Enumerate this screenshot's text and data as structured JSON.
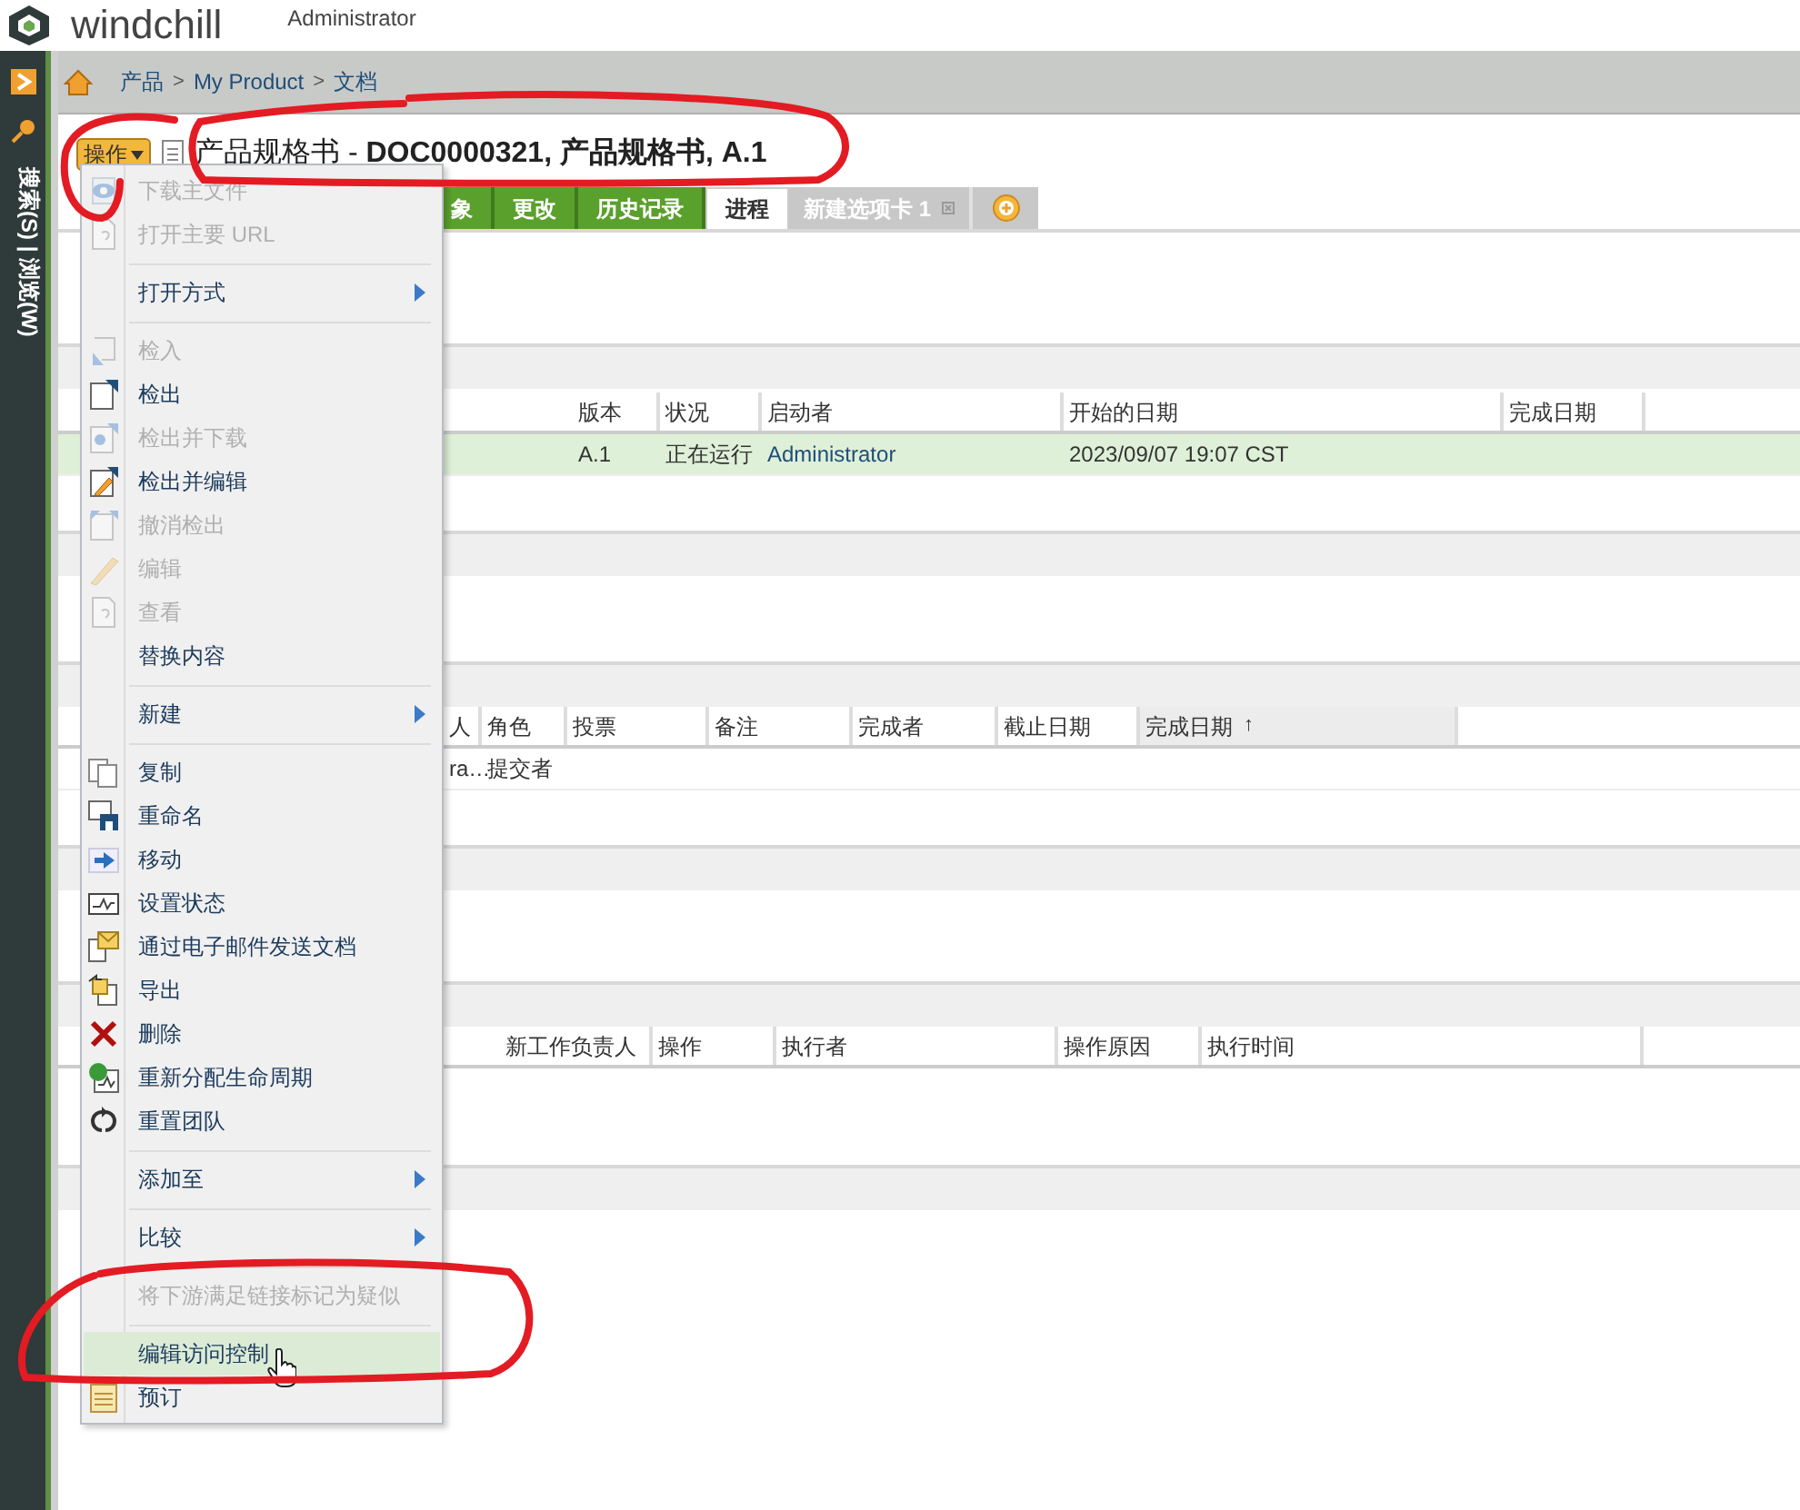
{
  "header": {
    "logo": "windchill",
    "user": "Administrator"
  },
  "sidebar": {
    "label": "搜索(S) | 浏览(W)"
  },
  "breadcrumb": [
    {
      "kind": "link",
      "text": "产品"
    },
    {
      "kind": "separator",
      "text": ">"
    },
    {
      "kind": "link",
      "text": "My Product"
    },
    {
      "kind": "separator",
      "text": ">"
    },
    {
      "kind": "link",
      "text": "文档"
    }
  ],
  "actions_button": {
    "label": "操作"
  },
  "title": "产品规格书 - **DOC0000321, 产品规格书, A.1**",
  "tabs": [
    {
      "label": "象",
      "kind": "standard",
      "selected": false
    },
    {
      "label": "更改",
      "kind": "standard",
      "selected": false
    },
    {
      "label": "历史记录",
      "kind": "standard",
      "selected": false
    },
    {
      "label": "进程",
      "kind": "standard",
      "selected": true
    },
    {
      "label": "新建选项卡 1",
      "kind": "custom",
      "selected": false
    },
    {
      "kind": "add",
      "selected": false
    }
  ],
  "tables": [
    {
      "columns": [
        {
          "label": "版本"
        },
        {
          "label": "状况"
        },
        {
          "label": "启动者"
        },
        {
          "label": "开始的日期"
        },
        {
          "label": "完成日期"
        }
      ],
      "rows": [
        {
          "selected": true,
          "cells": [
            {
              "text": "A.1",
              "link": false
            },
            {
              "text": "正在运行",
              "link": false
            },
            {
              "text": "Administrator",
              "link": true
            },
            {
              "text": "2023/09/07 19:07 CST",
              "link": false
            }
          ]
        }
      ]
    },
    {
      "columns": [
        {
          "label": "人",
          "sorted": false
        },
        {
          "label": "角色",
          "sorted": false
        },
        {
          "label": "投票",
          "sorted": false
        },
        {
          "label": "备注",
          "sorted": false
        },
        {
          "label": "完成者",
          "sorted": false
        },
        {
          "label": "截止日期",
          "sorted": false
        },
        {
          "label": "完成日期",
          "sorted": true,
          "sort_indicator": "↑"
        }
      ],
      "rows": [
        {
          "selected": false,
          "cells": [
            {
              "text": "ra…",
              "link": false
            },
            {
              "text": "提交者",
              "link": false
            }
          ]
        }
      ]
    },
    {
      "columns": [
        {
          "label": "新工作负责人"
        },
        {
          "label": "操作"
        },
        {
          "label": "执行者"
        },
        {
          "label": "操作原因"
        },
        {
          "label": "执行时间"
        }
      ]
    }
  ],
  "menu": [
    {
      "kind": "item",
      "label": "下载主文件",
      "icon": true,
      "disabled": true,
      "selected": false
    },
    {
      "kind": "item",
      "label": "打开主要 URL",
      "icon": true,
      "disabled": true,
      "selected": false
    },
    {
      "kind": "separator"
    },
    {
      "kind": "submenu",
      "label": "打开方式",
      "icon": false,
      "disabled": false,
      "selected": false
    },
    {
      "kind": "separator"
    },
    {
      "kind": "item",
      "label": "检入",
      "icon": true,
      "disabled": true,
      "selected": false
    },
    {
      "kind": "item",
      "label": "检出",
      "icon": true,
      "disabled": false,
      "selected": false
    },
    {
      "kind": "item",
      "label": "检出并下载",
      "icon": true,
      "disabled": true,
      "selected": false
    },
    {
      "kind": "item",
      "label": "检出并编辑",
      "icon": true,
      "disabled": false,
      "selected": false
    },
    {
      "kind": "item",
      "label": "撤消检出",
      "icon": true,
      "disabled": true,
      "selected": false
    },
    {
      "kind": "item",
      "label": "编辑",
      "icon": true,
      "disabled": true,
      "selected": false
    },
    {
      "kind": "item",
      "label": "查看",
      "icon": true,
      "disabled": true,
      "selected": false
    },
    {
      "kind": "item",
      "label": "替换内容",
      "icon": false,
      "disabled": false,
      "selected": false
    },
    {
      "kind": "separator"
    },
    {
      "kind": "submenu",
      "label": "新建",
      "icon": false,
      "disabled": false,
      "selected": false
    },
    {
      "kind": "separator"
    },
    {
      "kind": "item",
      "label": "复制",
      "icon": true,
      "disabled": false,
      "selected": false
    },
    {
      "kind": "item",
      "label": "重命名",
      "icon": true,
      "disabled": false,
      "selected": false
    },
    {
      "kind": "item",
      "label": "移动",
      "icon": true,
      "disabled": false,
      "selected": false
    },
    {
      "kind": "item",
      "label": "设置状态",
      "icon": true,
      "disabled": false,
      "selected": false
    },
    {
      "kind": "item",
      "label": "通过电子邮件发送文档",
      "icon": true,
      "disabled": false,
      "selected": false
    },
    {
      "kind": "item",
      "label": "导出",
      "icon": true,
      "disabled": false,
      "selected": false
    },
    {
      "kind": "item",
      "label": "删除",
      "icon": true,
      "disabled": false,
      "selected": false
    },
    {
      "kind": "item",
      "label": "重新分配生命周期",
      "icon": true,
      "disabled": false,
      "selected": false
    },
    {
      "kind": "item",
      "label": "重置团队",
      "icon": true,
      "disabled": false,
      "selected": false
    },
    {
      "kind": "separator"
    },
    {
      "kind": "submenu",
      "label": "添加至",
      "icon": false,
      "disabled": false,
      "selected": false
    },
    {
      "kind": "separator"
    },
    {
      "kind": "submenu",
      "label": "比较",
      "icon": false,
      "disabled": false,
      "selected": false
    },
    {
      "kind": "separator"
    },
    {
      "kind": "item",
      "label": "将下游满足链接标记为疑似",
      "icon": false,
      "disabled": true,
      "selected": false
    },
    {
      "kind": "separator"
    },
    {
      "kind": "item",
      "label": "编辑访问控制",
      "icon": false,
      "disabled": false,
      "selected": true
    },
    {
      "kind": "item",
      "label": "预订",
      "icon": true,
      "disabled": false,
      "selected": false
    }
  ]
}
